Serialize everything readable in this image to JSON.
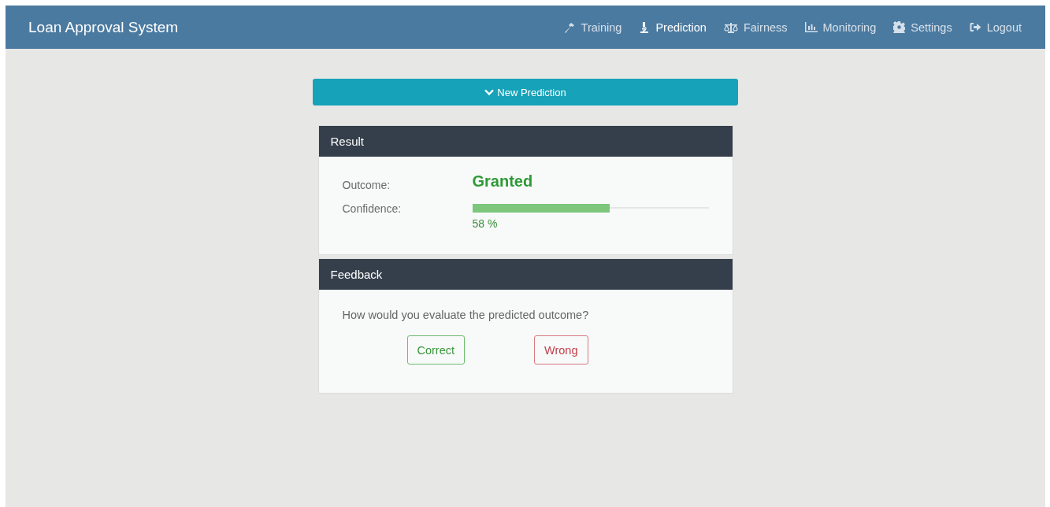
{
  "navbar": {
    "brand": "Loan Approval System",
    "items": [
      {
        "label": "Training",
        "selected": false
      },
      {
        "label": "Prediction",
        "selected": true
      },
      {
        "label": "Fairness",
        "selected": false
      },
      {
        "label": "Monitoring",
        "selected": false
      },
      {
        "label": "Settings",
        "selected": false
      },
      {
        "label": "Logout",
        "selected": false
      }
    ]
  },
  "toggle": {
    "label": "New Prediction",
    "expanded": true
  },
  "result": {
    "title": "Result",
    "outcome_label": "Outcome:",
    "outcome": "Granted",
    "confidence_label": "Confidence:",
    "level": 0.58,
    "reading": "58 %"
  },
  "feedback": {
    "title": "Feedback",
    "question": "How would you evaluate the predicted outcome?",
    "buttons": [
      {
        "label": "Correct",
        "kind": "positive"
      },
      {
        "label": "Wrong",
        "kind": "negative"
      }
    ]
  }
}
